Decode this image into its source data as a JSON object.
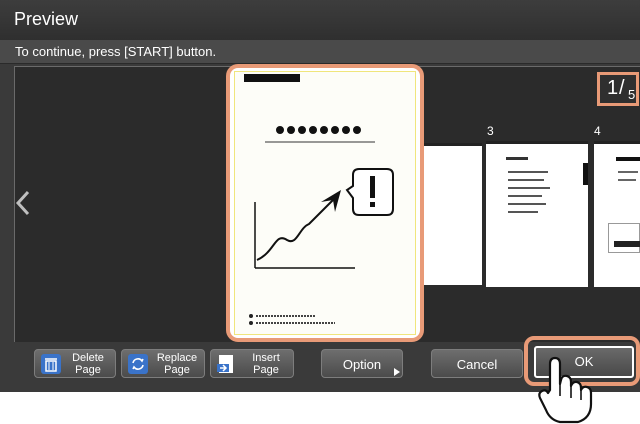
{
  "header": {
    "title": "Preview"
  },
  "instruction": "To continue, press [START] button.",
  "pages": {
    "current": "1",
    "separator": "/",
    "total": "5",
    "labels": [
      "3",
      "4"
    ]
  },
  "buttons": {
    "delete": [
      "Delete",
      "Page"
    ],
    "replace": [
      "Replace",
      "Page"
    ],
    "insert": [
      "Insert",
      "Page"
    ],
    "option": "Option",
    "cancel": "Cancel",
    "ok": "OK"
  },
  "icons": {
    "nav_left": "chevron-left-icon",
    "delete": "trash-icon",
    "replace": "replace-arrows-icon",
    "insert": "insert-page-icon",
    "option": "triangle-right-icon",
    "cursor": "hand-pointer-icon"
  },
  "colors": {
    "highlight": "#e89a77",
    "background": "#3a3a3a",
    "accent_border": "#f0e67c"
  }
}
